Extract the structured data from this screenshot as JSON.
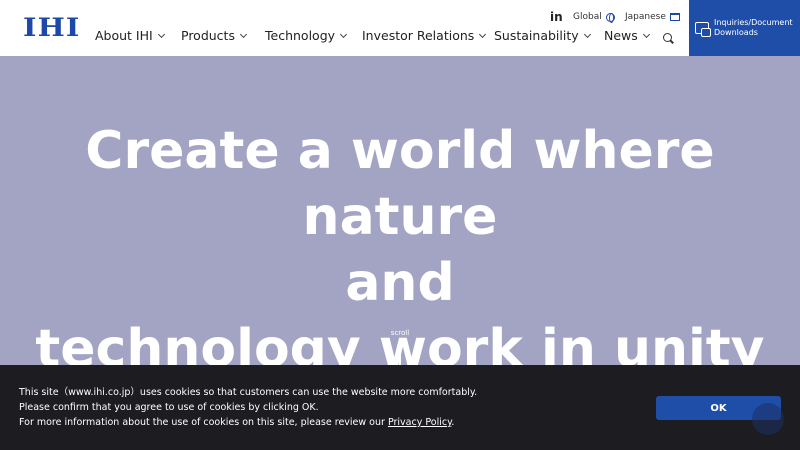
{
  "header": {
    "logo": "IHI",
    "utility": {
      "linkedin": "in",
      "global": "Global",
      "japanese": "Japanese"
    },
    "nav": [
      {
        "label": "About IHI"
      },
      {
        "label": "Products"
      },
      {
        "label": "Technology"
      },
      {
        "label": "Investor Relations"
      },
      {
        "label": "Sustainability"
      },
      {
        "label": "News"
      }
    ],
    "inquiry": {
      "line1": "Inquiries/Document",
      "line2": "Downloads"
    }
  },
  "hero": {
    "line1": "Create a world where nature",
    "line2": "and",
    "line3": "technology work in unity",
    "scroll": "scroll"
  },
  "cookie": {
    "line1": "This site（www.ihi.co.jp）uses cookies so that customers can use the website more comfortably.",
    "line2": "Please confirm that you agree to use of cookies by clicking OK.",
    "line3_prefix": "For more information about the use of cookies on this site, please review our ",
    "line3_link": "Privacy Policy",
    "line3_suffix": ".",
    "ok_label": "OK"
  },
  "colors": {
    "brand": "#1c48a8",
    "hero_bg": "#a3a4c3",
    "banner_bg": "#1d1d21"
  }
}
